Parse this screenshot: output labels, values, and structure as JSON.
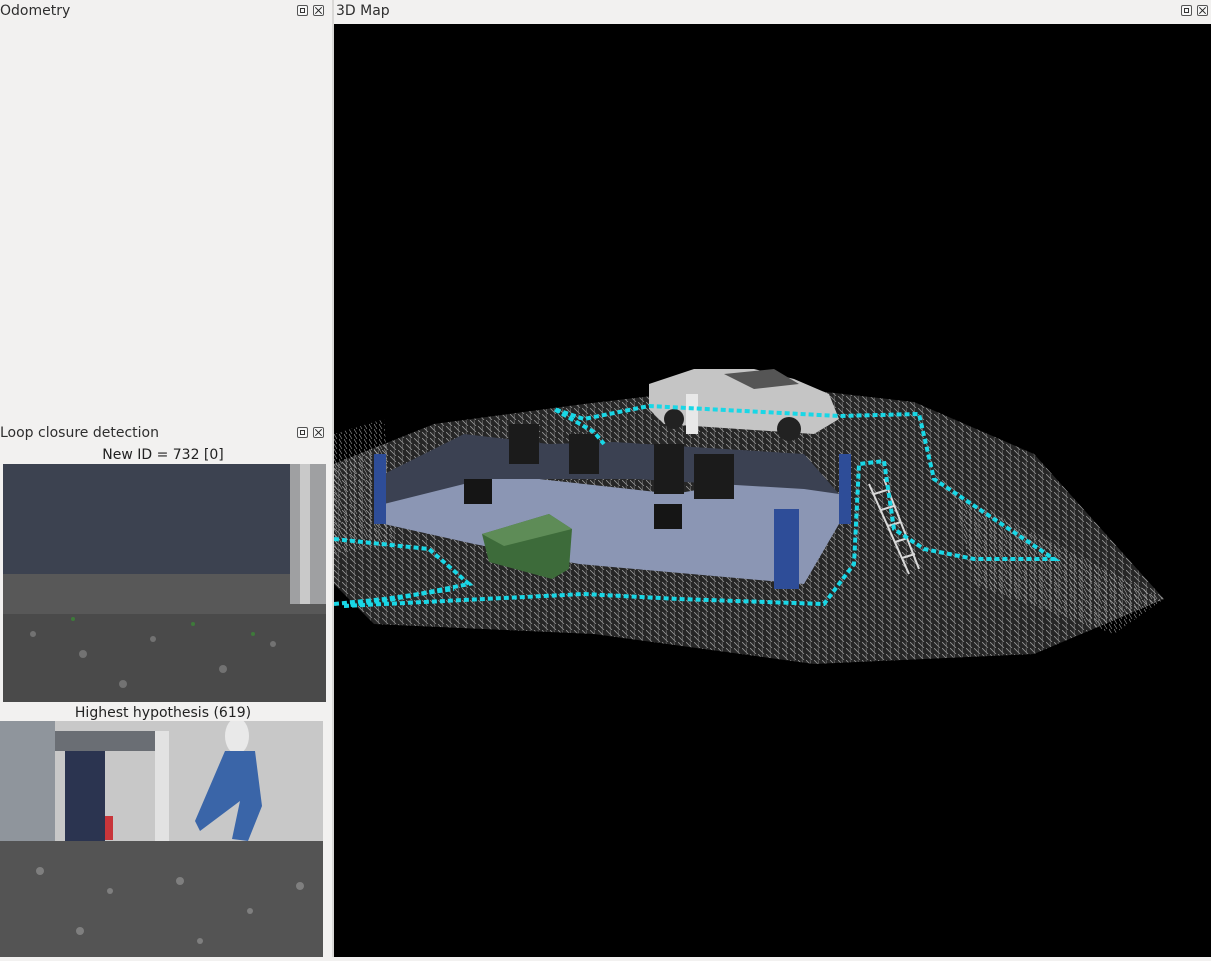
{
  "panels": {
    "odometry": {
      "title": "Odometry"
    },
    "map": {
      "title": "3D Map"
    },
    "loop_closure": {
      "title": "Loop closure detection",
      "new_id_label": "New ID = 732 [0]",
      "hypothesis_label": "Highest hypothesis (619)"
    }
  },
  "dock_buttons": {
    "float_icon": "float-icon",
    "close_icon": "close-icon"
  },
  "colors": {
    "background": "#f2f1f0",
    "map_background": "#000000",
    "trajectory": "#19d7e6",
    "point_cloud": "#9a9a9a"
  }
}
